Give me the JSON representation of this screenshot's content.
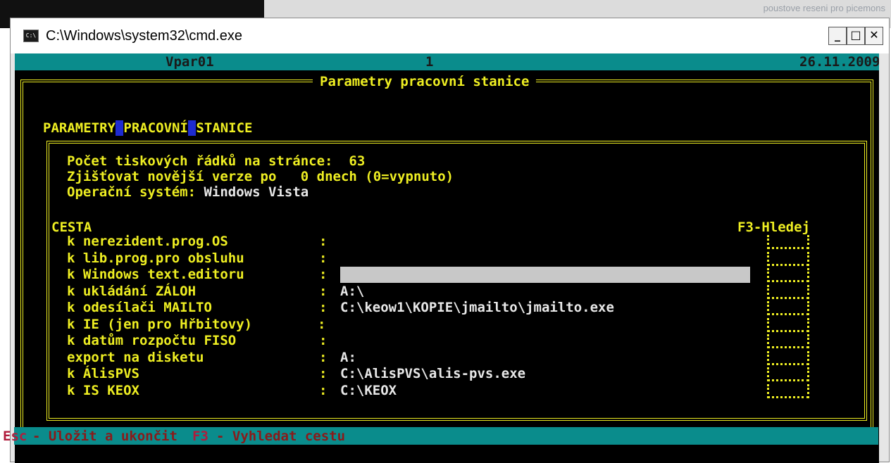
{
  "background": {
    "title_text": "poustove reseni pro picemons"
  },
  "window": {
    "title": "C:\\Windows\\system32\\cmd.exe",
    "icon_text": "C:\\",
    "controls": {
      "minimize": "_",
      "maximize": "□",
      "close": "✕"
    }
  },
  "status_row": {
    "left": "Vpar01",
    "center": "1",
    "date": "26.11.2009"
  },
  "banner_title": "Parametry pracovní stanice",
  "section_title": {
    "part1": "PARAMETRY",
    "part2": "PRACOVNÍ",
    "part3": "STANICE"
  },
  "params": {
    "line1_label": "Počet tiskových řádků na stránce:",
    "line1_value": "63",
    "line2_label": "Zjišťovat novější verze po",
    "line2_value": "0",
    "line2_suffix": "dnech (0=vypnuto)",
    "line3_label": "Operační systém:",
    "line3_value": "Windows Vista"
  },
  "cesta_header": "CESTA",
  "find_header": "F3-Hledej",
  "paths": [
    {
      "label": "k nerezident.prog.OS",
      "colon": ":",
      "value": ""
    },
    {
      "label": "k lib.prog.pro obsluhu",
      "colon": ":",
      "value": ""
    },
    {
      "label": "k Windows text.editoru",
      "colon": ":",
      "value": ""
    },
    {
      "label": "k ukládání ZÁLOH",
      "colon": ":",
      "value": "A:\\"
    },
    {
      "label": "k odesílači MAILTO",
      "colon": ":",
      "value": "C:\\keow1\\KOPIE\\jmailto\\jmailto.exe"
    },
    {
      "label": "k IE (jen pro Hřbitovy)",
      "colon": ":",
      "value": ""
    },
    {
      "label": "k datům rozpočtu FISO",
      "colon": ":",
      "value": ""
    },
    {
      "label": "export na disketu",
      "colon": ":",
      "value": "A:"
    },
    {
      "label": "k ÁlisPVS",
      "colon": ":",
      "value": "C:\\AlisPVS\\alis-pvs.exe"
    },
    {
      "label": "k IS KEOX",
      "colon": ":",
      "value": "C:\\KEOX"
    }
  ],
  "bottom_bar": {
    "key1": "Esc",
    "desc1": "- Uložit a ukončit",
    "key2": "F3",
    "desc2": "- Vyhledat cestu"
  },
  "colors": {
    "console_bg": "#000000",
    "console_fg": "#eeee22",
    "status_bg": "#0a8c8c",
    "highlight_bg": "#1e2bd0",
    "field_bg": "#c8c8c8",
    "bottom_fg": "#8a1a1a"
  }
}
